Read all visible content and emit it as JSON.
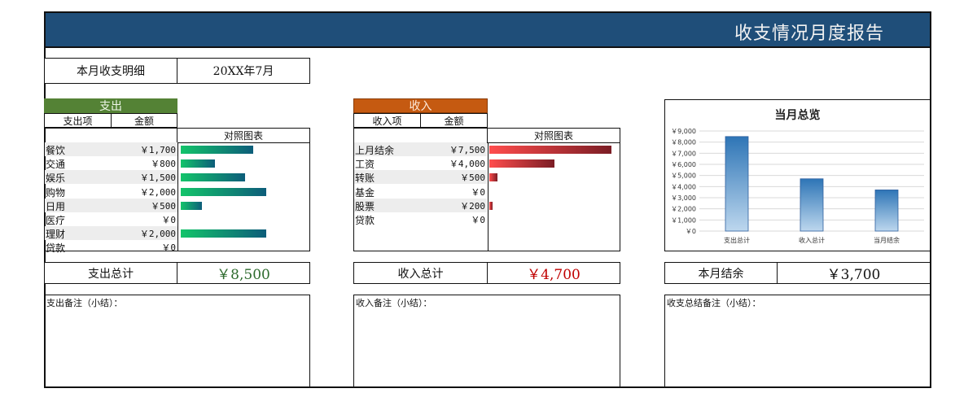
{
  "report": {
    "title": "收支情况月度报告"
  },
  "period": {
    "label": "本月收支明细",
    "value": "20XX年7月"
  },
  "expense": {
    "header": "支出",
    "col_item": "支出项",
    "col_amount": "金额",
    "col_chart": "对照图表",
    "items": [
      {
        "name": "餐饮",
        "amount": "￥1,700",
        "value": 1700
      },
      {
        "name": "交通",
        "amount": "￥800",
        "value": 800
      },
      {
        "name": "娱乐",
        "amount": "￥1,500",
        "value": 1500
      },
      {
        "name": "购物",
        "amount": "￥2,000",
        "value": 2000
      },
      {
        "name": "日用",
        "amount": "￥500",
        "value": 500
      },
      {
        "name": "医疗",
        "amount": "￥0",
        "value": 0
      },
      {
        "name": "理财",
        "amount": "￥2,000",
        "value": 2000
      },
      {
        "name": "贷款",
        "amount": "￥0",
        "value": 0
      }
    ],
    "total_label": "支出总计",
    "total_value": "￥8,500",
    "note_label": "支出备注（小结）："
  },
  "income": {
    "header": "收入",
    "col_item": "收入项",
    "col_amount": "金额",
    "col_chart": "对照图表",
    "items": [
      {
        "name": "上月结余",
        "amount": "￥7,500",
        "value": 7500
      },
      {
        "name": "工资",
        "amount": "￥4,000",
        "value": 4000
      },
      {
        "name": "转账",
        "amount": "￥500",
        "value": 500
      },
      {
        "name": "基金",
        "amount": "￥0",
        "value": 0
      },
      {
        "name": "股票",
        "amount": "￥200",
        "value": 200
      },
      {
        "name": "贷款",
        "amount": "￥0",
        "value": 0
      }
    ],
    "total_label": "收入总计",
    "total_value": "￥4,700",
    "note_label": "收入备注（小结）："
  },
  "balance": {
    "label": "本月结余",
    "value": "￥3,700",
    "note_label": "收支总结备注（小结）："
  },
  "colors": {
    "banner": "#1f4e79",
    "expense_header": "#548235",
    "income_header": "#c55a11",
    "chart_bar": "#2e75b6"
  },
  "chart_data": {
    "type": "bar",
    "title": "当月总览",
    "categories": [
      "支出总计",
      "收入总计",
      "当月结余"
    ],
    "values": [
      8500,
      4700,
      3700
    ],
    "ylim": [
      0,
      9000
    ],
    "yticks": [
      "￥0",
      "￥1,000",
      "￥2,000",
      "￥3,000",
      "￥4,000",
      "￥5,000",
      "￥6,000",
      "￥7,000",
      "￥8,000",
      "￥9,000"
    ],
    "grid": true,
    "xlabel": "",
    "ylabel": ""
  }
}
